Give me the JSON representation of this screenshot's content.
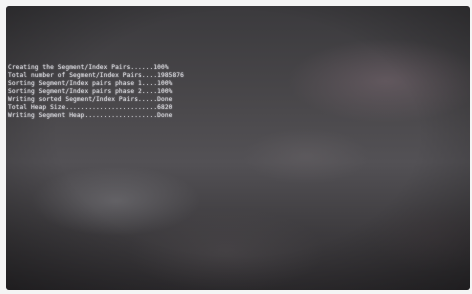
{
  "console": {
    "lines": [
      "Creating the Segment/Index Pairs......100%",
      "Total number of Segment/Index Pairs....1985876",
      "Sorting Segment/Index pairs phase 1....100%",
      "Sorting Segment/Index pairs phase 2....100%",
      "Writing sorted Segment/Index Pairs.....Done",
      "Total Heap Size........................6820",
      "Writing Segment Heap...................Done"
    ]
  },
  "colors": {
    "text": "#e6e6ea",
    "screen_background": "#47454a"
  }
}
